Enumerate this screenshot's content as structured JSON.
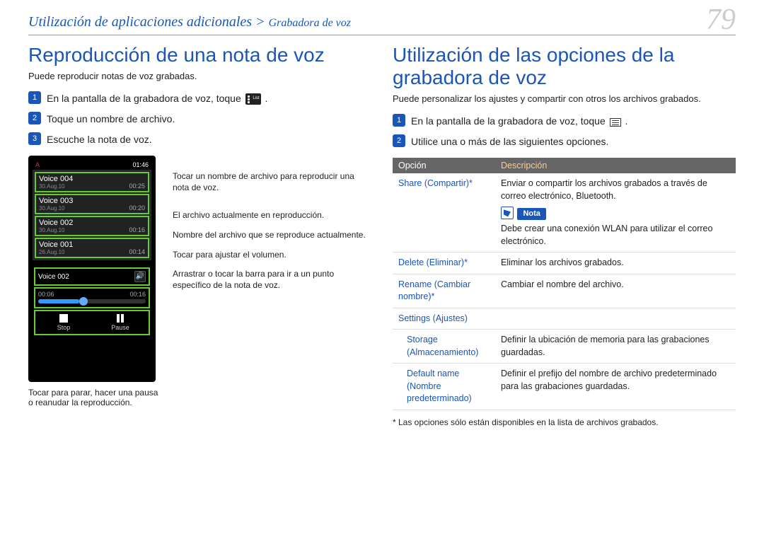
{
  "header": {
    "breadcrumb_main": "Utilización de aplicaciones adicionales",
    "breadcrumb_sep": ">",
    "breadcrumb_sub": "Grabadora de voz",
    "page_number": "79"
  },
  "left": {
    "title": "Reproducción de una nota de voz",
    "lead": "Puede reproducir notas de voz grabadas.",
    "steps": [
      "En la pantalla de la grabadora de voz, toque ",
      "Toque un nombre de archivo.",
      "Escuche la nota de voz."
    ],
    "step1_suffix": ".",
    "device": {
      "status_left": "A",
      "status_right": "01:46",
      "files": [
        {
          "name": "Voice 004",
          "date": "30.Aug.10",
          "dur": "00:25"
        },
        {
          "name": "Voice 003",
          "date": "30.Aug.10",
          "dur": "00:20"
        },
        {
          "name": "Voice 002",
          "date": "30.Aug.10",
          "dur": "00:16"
        },
        {
          "name": "Voice 001",
          "date": "26.Aug.10",
          "dur": "00:14"
        }
      ],
      "now_playing": "Voice 002",
      "time_elapsed": "00:06",
      "time_total": "00:16",
      "stop_label": "Stop",
      "pause_label": "Pause"
    },
    "callouts": {
      "c1": "Tocar un nombre de archivo para reproducir una nota de voz.",
      "c2": "El archivo actualmente en reproducción.",
      "c3": "Nombre del archivo que se reproduce actualmente.",
      "c4": "Tocar para ajustar el volumen.",
      "c5": "Arrastrar o tocar la barra para ir a un punto específico de la nota de voz.",
      "below": "Tocar para parar, hacer una pausa o reanudar la reproducción."
    }
  },
  "right": {
    "title": "Utilización de las opciones de la grabadora de voz",
    "lead": "Puede personalizar los ajustes y compartir con otros los archivos grabados.",
    "steps": [
      "En la pantalla de la grabadora de voz, toque ",
      "Utilice una o más de las siguientes opciones."
    ],
    "step1_suffix": ".",
    "table_headers": {
      "opt": "Opción",
      "desc": "Descripción"
    },
    "rows": {
      "share": {
        "name": "Share (Compartir)*",
        "desc1": "Enviar o compartir los archivos grabados a través de correo electrónico, Bluetooth.",
        "nota_label": "Nota",
        "nota_text": "Debe crear una conexión WLAN para utilizar el correo electrónico."
      },
      "delete": {
        "name": "Delete (Eliminar)*",
        "desc": "Eliminar los archivos grabados."
      },
      "rename": {
        "name": "Rename (Cambiar nombre)*",
        "desc": "Cambiar el nombre del archivo."
      },
      "settings": {
        "name": "Settings (Ajustes)"
      },
      "storage": {
        "name": "Storage (Almacenamiento)",
        "desc": "Definir la ubicación de memoria para las grabaciones guardadas."
      },
      "default_name": {
        "name": "Default name (Nombre predeterminado)",
        "desc": "Definir el prefijo del nombre de archivo predeterminado para las grabaciones guardadas."
      }
    },
    "footnote": "* Las opciones sólo están disponibles en la lista de archivos grabados."
  }
}
